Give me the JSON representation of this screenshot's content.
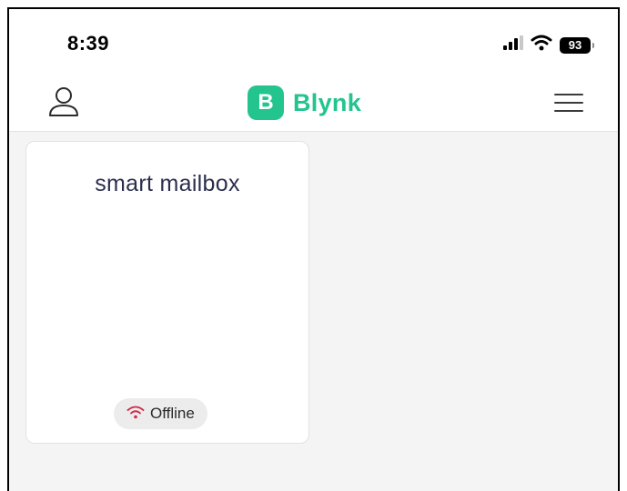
{
  "status_bar": {
    "time": "8:39",
    "battery_level": "93",
    "icons": [
      "cellular-signal-icon",
      "wifi-icon",
      "battery-icon"
    ]
  },
  "header": {
    "logo_letter": "B",
    "app_name": "Blynk",
    "icons": [
      "profile-icon",
      "hamburger-menu-icon"
    ]
  },
  "devices": [
    {
      "name": "smart mailbox",
      "status": "Offline",
      "status_icon": "wifi-off-icon"
    }
  ],
  "colors": {
    "brand": "#23c48e",
    "device_name": "#2b2f4e",
    "offline": "#d2284a",
    "background": "#f4f4f4"
  }
}
